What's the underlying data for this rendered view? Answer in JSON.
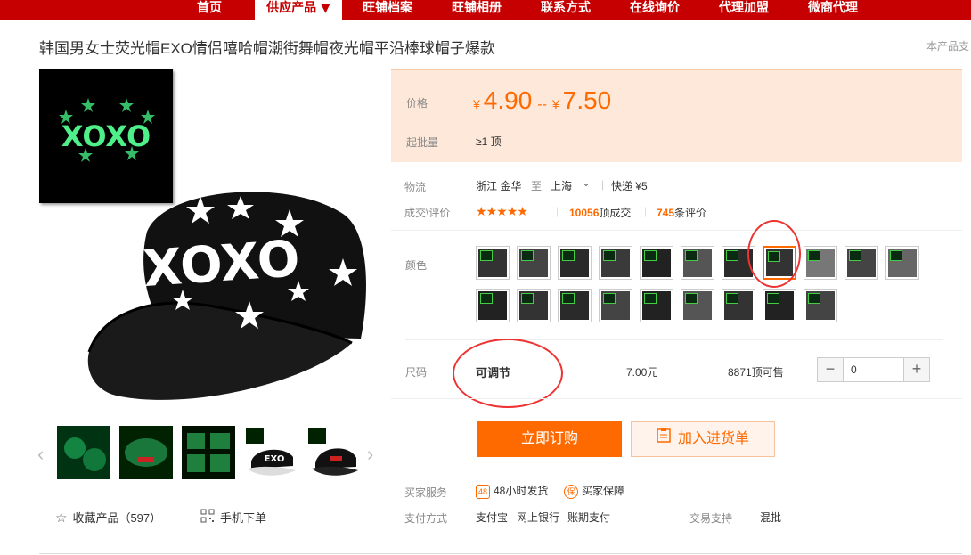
{
  "nav": {
    "items": [
      "首页",
      "供应产品 ▼",
      "旺铺档案",
      "旺铺相册",
      "联系方式",
      "在线询价",
      "代理加盟",
      "微商代理"
    ],
    "active_index": 1
  },
  "product": {
    "title": "韩国男女士荧光帽EXO情侣嘻哈帽潮街舞帽夜光帽平沿棒球帽子爆款",
    "support_text": "本产品支"
  },
  "images": {
    "thumb_text": "XOXO",
    "main_text": "XOXO",
    "strip": [
      "glow-1",
      "glow-2",
      "glow-3",
      "exo-cap",
      "star-cap"
    ],
    "strip_text": [
      "",
      "",
      "",
      "EXO",
      ""
    ]
  },
  "actions": {
    "favorite": "收藏产品（597）",
    "mobile_order": "手机下单",
    "buy_now": "立即订购",
    "add_to_cart": "加入进货单"
  },
  "price": {
    "label": "价格",
    "currency": "¥",
    "low": "4.90",
    "separator": "--",
    "high": "7.50",
    "min_order_label": "起批量",
    "min_order": "≥1 顶"
  },
  "logistics": {
    "label": "物流",
    "from": "浙江 金华",
    "to_word": "至",
    "to": "上海",
    "express": "快递 ¥5"
  },
  "reviews": {
    "label": "成交\\评价",
    "rating": 4.5,
    "deals_count": "10056",
    "deals_unit": "顶成交",
    "review_count": "745",
    "review_unit": "条评价"
  },
  "color": {
    "label": "颜色",
    "selected_index": 7
  },
  "size": {
    "label": "尺码",
    "value": "可调节",
    "price": "7.00元",
    "stock": "8871顶可售",
    "qty": "0",
    "minus": "−",
    "plus": "+"
  },
  "service": {
    "label": "买家服务",
    "item1_icon": "48",
    "item1": "48小时发货",
    "item2_icon": "保",
    "item2": "买家保障"
  },
  "payment": {
    "label": "支付方式",
    "methods": [
      "支付宝",
      "网上银行",
      "账期支付"
    ],
    "trade_label": "交易支持",
    "trade_value": "混批"
  },
  "colors": {
    "brand_red": "#c60000",
    "accent_orange": "#ff6a00",
    "price_bg": "#fde8da",
    "annotation_red": "#e33333"
  }
}
